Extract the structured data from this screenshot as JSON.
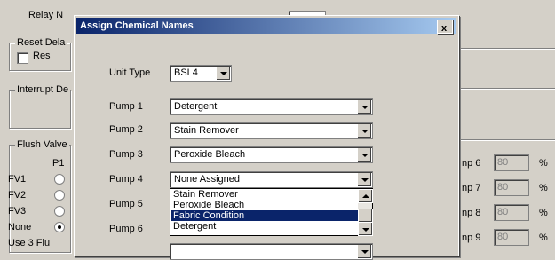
{
  "background": {
    "relay_label": "Relay N",
    "reset_group": "Reset Dela",
    "reset_check": "Res",
    "interrupt_group": "Interrupt De",
    "flush_group": "Flush Valve",
    "p1_header": "P1",
    "rows": [
      "FV1",
      "FV2",
      "FV3",
      "None"
    ],
    "use3": "Use 3 Flu",
    "right_pumps": [
      {
        "label": "np 6",
        "value": "80",
        "unit": "%"
      },
      {
        "label": "np 7",
        "value": "80",
        "unit": "%"
      },
      {
        "label": "np 8",
        "value": "80",
        "unit": "%"
      },
      {
        "label": "np 9",
        "value": "80",
        "unit": "%"
      }
    ]
  },
  "dialog": {
    "title": "Assign Chemical Names",
    "close_label": "x",
    "unit_type_label": "Unit Type",
    "unit_type_value": "BSL4",
    "pumps": [
      {
        "label": "Pump 1",
        "value": "Detergent"
      },
      {
        "label": "Pump 2",
        "value": "Stain Remover"
      },
      {
        "label": "Pump 3",
        "value": "Peroxide Bleach"
      },
      {
        "label": "Pump 4",
        "value": "None Assigned"
      },
      {
        "label": "Pump 5",
        "value": ""
      },
      {
        "label": "Pump 6",
        "value": ""
      }
    ],
    "dropdown_options": [
      "Stain Remover",
      "Peroxide Bleach",
      "Fabric Condition",
      "Detergent"
    ],
    "selected_option_index": 2
  }
}
